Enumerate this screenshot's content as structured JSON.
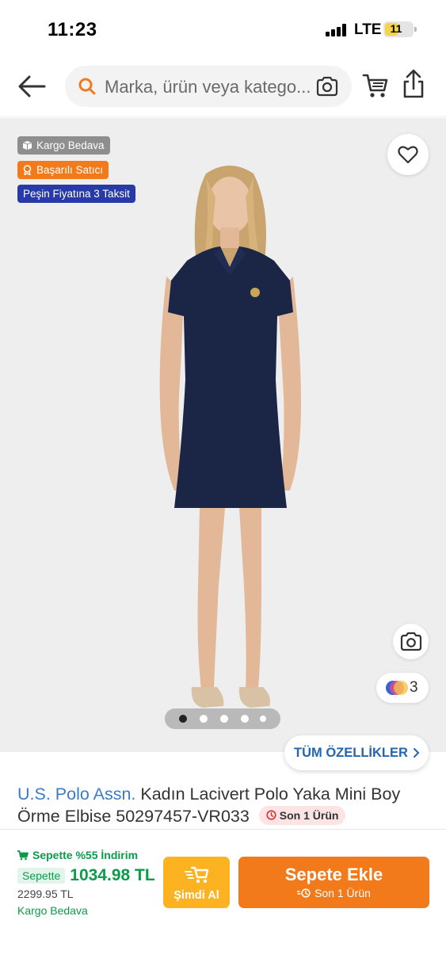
{
  "status_bar": {
    "time": "11:23",
    "network": "LTE",
    "battery": "11"
  },
  "header": {
    "search_placeholder": "Marka, ürün veya katego...",
    "icons": [
      "back-arrow-icon",
      "search-icon",
      "camera-icon",
      "cart-icon",
      "share-icon"
    ]
  },
  "gallery": {
    "badges": {
      "cargo": "Kargo Bedava",
      "seller": "Başarılı Satıcı",
      "taksit": "Peşin Fiyatına 3 Taksit"
    },
    "color_count": "3",
    "image_count": 5,
    "active_image": 1
  },
  "all_features": "TÜM ÖZELLİKLER",
  "product": {
    "brand": "U.S. Polo Assn.",
    "name": "Kadın Lacivert Polo Yaka Mini Boy Örme Elbise 50297457-VR033",
    "stock_badge": "Son 1 Ürün"
  },
  "price": {
    "discount_text": "Sepette %55 İndirim",
    "cart_tag": "Sepette",
    "final_price": "1034.98 TL",
    "old_price": "2299.95 TL",
    "shipping": "Kargo Bedava"
  },
  "actions": {
    "buy_now": "Şimdi Al",
    "add_to_cart": "Sepete Ekle",
    "add_to_cart_sub": "Son 1 Ürün"
  },
  "colors": {
    "brand_orange": "#f27a1a",
    "buy_now_yellow": "#fdb321",
    "success_green": "#0b9b4b",
    "link_blue": "#2265b0",
    "taksit_blue": "#283aa8"
  }
}
